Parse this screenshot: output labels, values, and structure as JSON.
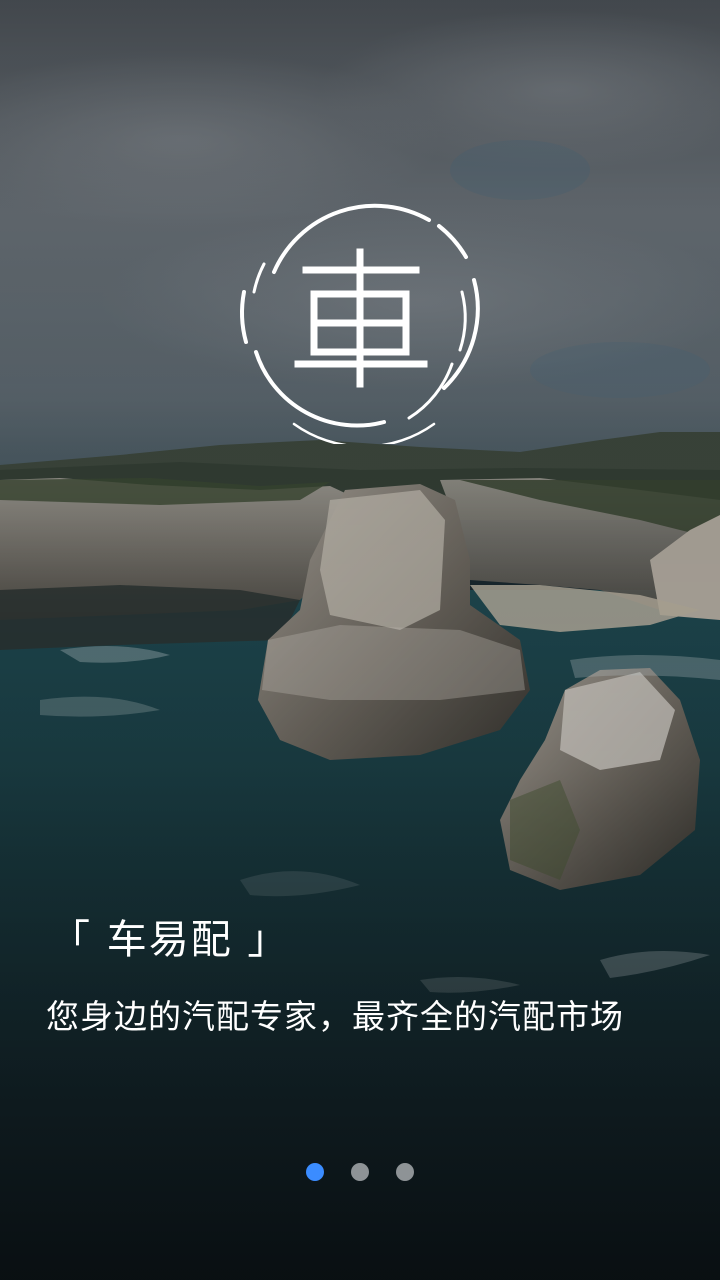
{
  "splash": {
    "logo_char": "車",
    "brand": "「 车易配 」",
    "tagline": "您身边的汽配专家，最齐全的汽配市场"
  },
  "pager": {
    "total": 3,
    "active_index": 0
  },
  "colors": {
    "active_dot": "#3b8cff",
    "inactive_dot": "#8e9396",
    "text": "#ffffff"
  },
  "icons": {
    "logo": "car-character-ring-logo"
  }
}
